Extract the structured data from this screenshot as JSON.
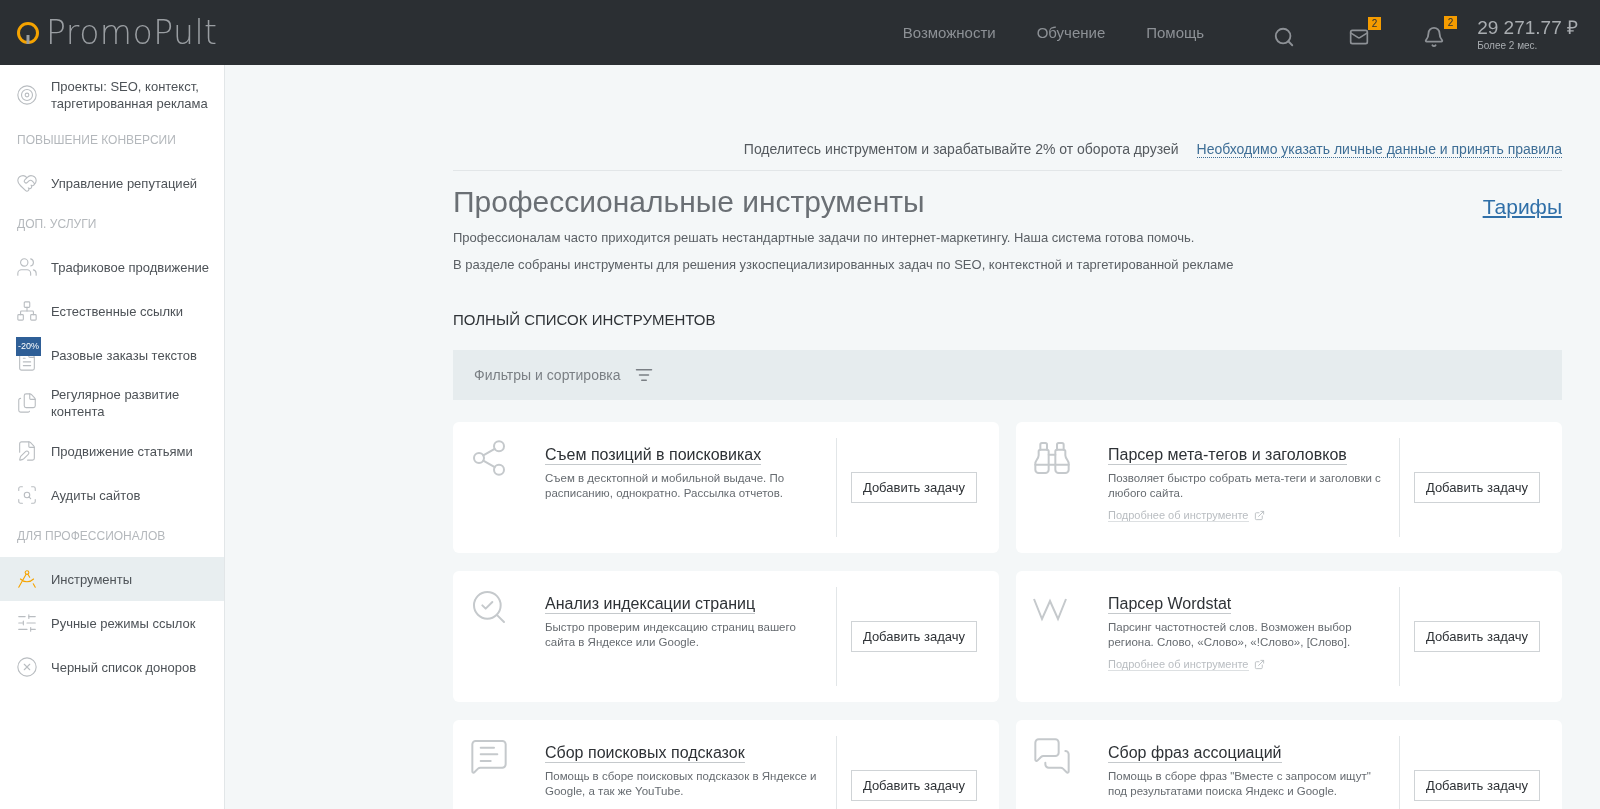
{
  "header": {
    "logo": "PromoPult",
    "nav": [
      "Возможности",
      "Обучение",
      "Помощь"
    ],
    "mail_badge": "2",
    "bell_badge": "2",
    "balance": "29 271.77 ₽",
    "balance_note": "Более 2 мес."
  },
  "sidebar": {
    "items": [
      {
        "kind": "item",
        "label": "Проекты: SEO, контекст, таргетированная реклама",
        "selected": false
      },
      {
        "kind": "section",
        "label": "ПОВЫШЕНИЕ КОНВЕРСИИ"
      },
      {
        "kind": "item",
        "label": "Управление репутацией",
        "selected": false
      },
      {
        "kind": "section",
        "label": "ДОП. УСЛУГИ"
      },
      {
        "kind": "item",
        "label": "Трафиковое продвижение",
        "selected": false
      },
      {
        "kind": "item",
        "label": "Естественные ссылки",
        "selected": false
      },
      {
        "kind": "item",
        "label": "Разовые заказы текстов",
        "selected": false,
        "badge": "-20%"
      },
      {
        "kind": "item",
        "label": "Регулярное развитие контента",
        "selected": false
      },
      {
        "kind": "item",
        "label": "Продвижение статьями",
        "selected": false
      },
      {
        "kind": "item",
        "label": "Аудиты сайтов",
        "selected": false
      },
      {
        "kind": "section",
        "label": "ДЛЯ ПРОФЕССИОНАЛОВ"
      },
      {
        "kind": "item",
        "label": "Инструменты",
        "selected": true
      },
      {
        "kind": "item",
        "label": "Ручные режимы ссылок",
        "selected": false
      },
      {
        "kind": "item",
        "label": "Черный список доноров",
        "selected": false
      }
    ]
  },
  "main": {
    "share_text": "Поделитесь инструментом и зарабатывайте 2% от оборота друзей",
    "share_link": "Необходимо указать личные данные и принять правила",
    "title": "Профессиональные инструменты",
    "tariffs_link": "Тарифы",
    "descriptions": [
      "Профессионалам часто приходится решать нестандартные задачи по интернет-маркетингу. Наша система готова помочь.",
      "В разделе собраны инструменты для решения узкоспециализированных задач по SEO, контекстной и таргетированной рекламе"
    ],
    "list_heading": "ПОЛНЫЙ СПИСОК ИНСТРУМЕНТОВ",
    "filters": "Фильтры и сортировка",
    "tools": [
      {
        "title": "Съем позиций в поисковиках",
        "description": "Съем в десктопной и мобильной выдаче. По расписанию, однократно. Рассылка отчетов.",
        "button": "Добавить задачу"
      },
      {
        "title": "Парсер мета-тегов и заголовков",
        "description": "Позволяет быстро собрать мета-теги и заголовки с любого сайта.",
        "more_link": "Подробнее об инструменте",
        "button": "Добавить задачу"
      },
      {
        "title": "Анализ индексации страниц",
        "description": "Быстро проверим индексацию страниц вашего сайта в Яндексе или Google.",
        "button": "Добавить задачу"
      },
      {
        "title": "Парсер Wordstat",
        "description": "Парсинг частотностей слов. Возможен выбор региона. Слово, «Слово», «!Слово», [Слово].",
        "more_link": "Подробнее об инструменте",
        "button": "Добавить задачу"
      },
      {
        "title": "Сбор поисковых подсказок",
        "description": "Помощь в сборе поисковых подсказок в Яндексе и Google, а так же YouTube.",
        "button": "Добавить задачу"
      },
      {
        "title": "Сбор фраз ассоциаций",
        "description": "Помощь в сборе фраз \"Вместе с запросом ищут\" под результатами поиска Яндекс и Google.",
        "button": "Добавить задачу"
      }
    ]
  }
}
